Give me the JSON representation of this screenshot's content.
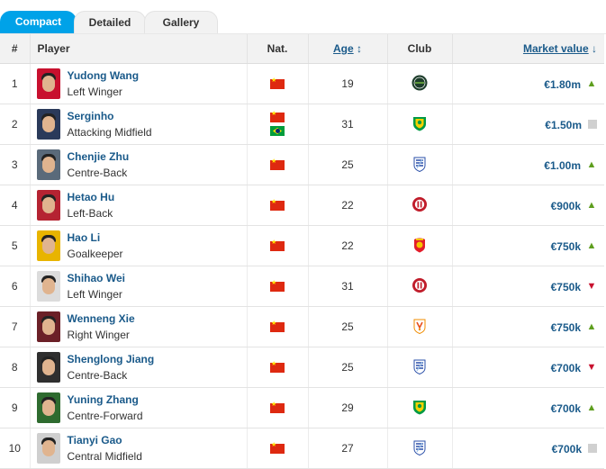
{
  "tabs": {
    "compact": "Compact",
    "detailed": "Detailed",
    "gallery": "Gallery"
  },
  "headers": {
    "num": "#",
    "player": "Player",
    "nat": "Nat.",
    "age": "Age",
    "age_sort": "↕",
    "club": "Club",
    "market_value": "Market value",
    "mv_sort": "↓"
  },
  "colors": {
    "accent": "#00a2e8",
    "link": "#1a5a8a",
    "up": "#5e9e1e",
    "down": "#c8102e"
  },
  "rows": [
    {
      "num": "1",
      "name": "Yudong Wang",
      "position": "Left Winger",
      "nationality": [
        "china-flag"
      ],
      "age": "19",
      "club_icon": "zhejiang-crest",
      "value": "€1.80m",
      "trend": "up"
    },
    {
      "num": "2",
      "name": "Serginho",
      "position": "Attacking Midfield",
      "nationality": [
        "china-flag",
        "brazil-flag"
      ],
      "age": "31",
      "club_icon": "beijing-guoan-crest",
      "value": "€1.50m",
      "trend": "same"
    },
    {
      "num": "3",
      "name": "Chenjie Zhu",
      "position": "Centre-Back",
      "nationality": [
        "china-flag"
      ],
      "age": "25",
      "club_icon": "shanghai-shenhua-crest",
      "value": "€1.00m",
      "trend": "up"
    },
    {
      "num": "4",
      "name": "Hetao Hu",
      "position": "Left-Back",
      "nationality": [
        "china-flag"
      ],
      "age": "22",
      "club_icon": "chengdu-rongcheng-crest",
      "value": "€900k",
      "trend": "up"
    },
    {
      "num": "5",
      "name": "Hao Li",
      "position": "Goalkeeper",
      "nationality": [
        "china-flag"
      ],
      "age": "22",
      "club_icon": "qingdao-crest",
      "value": "€750k",
      "trend": "up"
    },
    {
      "num": "6",
      "name": "Shihao Wei",
      "position": "Left Winger",
      "nationality": [
        "china-flag"
      ],
      "age": "31",
      "club_icon": "chengdu-rongcheng-crest",
      "value": "€750k",
      "trend": "down"
    },
    {
      "num": "7",
      "name": "Wenneng Xie",
      "position": "Right Winger",
      "nationality": [
        "china-flag"
      ],
      "age": "25",
      "club_icon": "shandong-taishan-crest",
      "value": "€750k",
      "trend": "up"
    },
    {
      "num": "8",
      "name": "Shenglong Jiang",
      "position": "Centre-Back",
      "nationality": [
        "china-flag"
      ],
      "age": "25",
      "club_icon": "shanghai-shenhua-crest",
      "value": "€700k",
      "trend": "down"
    },
    {
      "num": "9",
      "name": "Yuning Zhang",
      "position": "Centre-Forward",
      "nationality": [
        "china-flag"
      ],
      "age": "29",
      "club_icon": "beijing-guoan-crest",
      "value": "€700k",
      "trend": "up"
    },
    {
      "num": "10",
      "name": "Tianyi Gao",
      "position": "Central Midfield",
      "nationality": [
        "china-flag"
      ],
      "age": "27",
      "club_icon": "shanghai-shenhua-crest",
      "value": "€700k",
      "trend": "same"
    }
  ]
}
